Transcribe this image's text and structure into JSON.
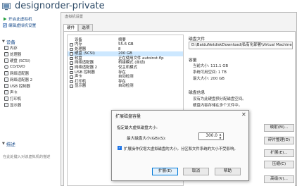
{
  "window": {
    "title": "designorder-private",
    "settings_title": "虚拟机设置"
  },
  "actions": [
    {
      "icon": "play-icon",
      "label": "开启此虚拟机",
      "color": "#1f9e3a"
    },
    {
      "icon": "edit-icon",
      "label": "编辑虚拟机设置",
      "color": "#3d6fb4"
    }
  ],
  "left_sections": {
    "devices": "设备",
    "description": "描述",
    "description_placeholder": "在此处键入对该虚拟机的描述"
  },
  "left_devices": [
    "内存",
    "处理器",
    "硬盘 (SCSI)",
    "CD/DVD",
    "网络适配器",
    "网络适配器 2",
    "USB 控制器",
    "声卡",
    "打印机",
    "显示器"
  ],
  "tabs": [
    {
      "label": "硬件",
      "active": true
    },
    {
      "label": "选项",
      "active": false
    }
  ],
  "device_table": {
    "headers": {
      "device": "设备",
      "summary": "摘要"
    },
    "rows": [
      {
        "device": "内存",
        "summary": "55.6 GB",
        "selected": false
      },
      {
        "device": "处理器",
        "summary": "8",
        "selected": false
      },
      {
        "device": "硬盘 (SCSI)",
        "summary": "200 GB",
        "selected": true
      },
      {
        "device": "软盘",
        "summary": "正在使用文件 autoinst.flp",
        "selected": false
      },
      {
        "device": "网络适配器",
        "summary": "桥接模式 (自动)",
        "selected": false
      },
      {
        "device": "网络适配器 2",
        "summary": "仅主机模式",
        "selected": false
      },
      {
        "device": "USB 控制器",
        "summary": "存在",
        "selected": false
      },
      {
        "device": "声卡",
        "summary": "自动检测",
        "selected": false
      },
      {
        "device": "打印机",
        "summary": "存在",
        "selected": false
      },
      {
        "device": "显示器",
        "summary": "自动检测",
        "selected": false
      }
    ]
  },
  "disk_file": {
    "title": "磁盘文件",
    "path": "D:\\BaiduNetdiskDownload\\私有化部署\\Virtual Machine"
  },
  "capacity": {
    "title": "容量",
    "current": "当前大小: 111.1 GB",
    "system_free": "系统可用空间: 1 TB",
    "max": "最大大小: 200 GB"
  },
  "disk_info": {
    "title": "磁盘信息",
    "line1": "没有为此硬盘预分配磁盘空间。",
    "line2": "硬盘内容存储在多个文件中。"
  },
  "right_buttons": [
    "映射(M)...",
    "碎片整理(D)",
    "扩展(E)...",
    "压缩(C)",
    "高级(V)..."
  ],
  "expand_dialog": {
    "title": "扩展磁盘容量",
    "close": "✕",
    "label_specify": "指定最大虚拟磁盘大小:",
    "label_max": "最大磁盘大小(GB)(S):",
    "value": "300.0",
    "checkbox_checked": true,
    "checkbox_label": "扩展操作仅增大虚拟磁盘的大小。分区和文件系统的大小不受影响。",
    "buttons": {
      "expand": "扩展(E)",
      "cancel": "取消",
      "help": "帮助"
    }
  },
  "colors": {
    "accent": "#1a4d8c",
    "selection": "#cde8ff",
    "primary_border": "#0078d7"
  }
}
